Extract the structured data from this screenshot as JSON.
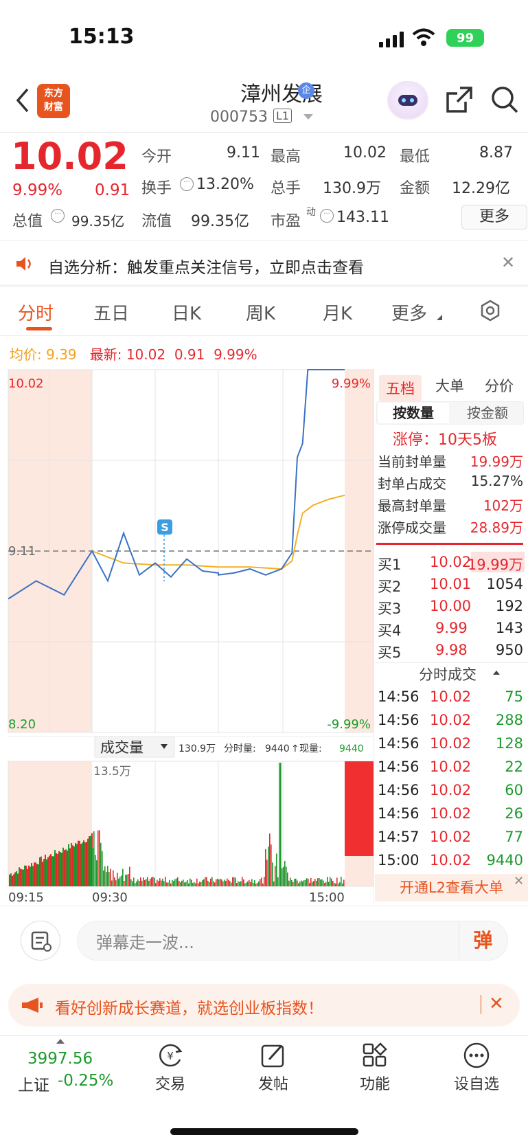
{
  "status_bar": {
    "time": "15:13",
    "battery": "99"
  },
  "header": {
    "logo_text_1": "东方",
    "logo_text_2": "财富",
    "stock_name": "漳州发展",
    "name_badge": "企",
    "stock_code": "000753",
    "level": "L1"
  },
  "quote": {
    "price": "10.02",
    "pct_change": "9.99%",
    "change": "0.91",
    "open_label": "今开",
    "open": "9.11",
    "high_label": "最高",
    "high": "10.02",
    "low_label": "最低",
    "low": "8.87",
    "turnover_label": "换手",
    "turnover": "13.20%",
    "volume_label": "总手",
    "volume": "130.9万",
    "amount_label": "金额",
    "amount": "12.29亿",
    "mktcap_label": "总值",
    "mktcap": "99.35亿",
    "float_label": "流值",
    "float_cap": "99.35亿",
    "pe_label": "市盈",
    "pe_sup": "动",
    "pe": "143.11",
    "more_button": "更多"
  },
  "notice": {
    "text": "自选分析：触发重点关注信号，立即点击查看"
  },
  "tabs": [
    "分时",
    "五日",
    "日K",
    "周K",
    "月K",
    "更多"
  ],
  "info_line": {
    "avg_label": "均价:",
    "avg": "9.39",
    "latest_label": "最新:",
    "latest": "10.02",
    "latest_chg": "0.91",
    "latest_pct": "9.99%"
  },
  "chart_data": {
    "type": "line",
    "title": "",
    "y_max_label": "10.02",
    "y_ref_label": "9.11",
    "y_min_label": "8.20",
    "pct_max_label": "9.99%",
    "pct_min_label": "-9.99%",
    "ylim": [
      8.2,
      10.02
    ],
    "reference_price": 9.11,
    "marker": "S",
    "series": [
      {
        "name": "price",
        "x": [
          "09:15",
          "09:20",
          "09:25",
          "09:30",
          "09:45",
          "10:00",
          "10:15",
          "10:30",
          "10:45",
          "11:00",
          "11:15",
          "11:30",
          "13:00",
          "13:15",
          "13:30",
          "13:45",
          "14:00",
          "14:10",
          "14:15",
          "14:20",
          "14:25",
          "14:30",
          "14:35",
          "14:40",
          "14:45",
          "14:50",
          "14:56",
          "15:00"
        ],
        "values": [
          8.87,
          8.96,
          8.89,
          9.11,
          8.96,
          9.2,
          8.99,
          9.05,
          8.98,
          9.07,
          9.01,
          9.0,
          8.99,
          9.0,
          9.02,
          8.99,
          9.02,
          9.1,
          9.58,
          9.65,
          10.02,
          10.02,
          10.02,
          10.02,
          10.02,
          10.02,
          10.02,
          10.02
        ]
      },
      {
        "name": "avg",
        "x": [
          "09:30",
          "10:00",
          "10:30",
          "11:00",
          "11:30",
          "13:00",
          "13:30",
          "14:00",
          "14:10",
          "14:15",
          "14:20",
          "14:30",
          "14:45",
          "15:00"
        ],
        "values": [
          9.11,
          9.05,
          9.04,
          9.04,
          9.03,
          9.03,
          9.03,
          9.02,
          9.06,
          9.19,
          9.3,
          9.34,
          9.37,
          9.39
        ]
      }
    ],
    "volume": {
      "label": "成交量",
      "total": "130.9万",
      "tick_label": "分时量:",
      "tick_vol": "9440",
      "now_label": "现量:",
      "now_vol": "9440",
      "peak_label": "13.5万"
    },
    "x_tick_labels": [
      "09:15",
      "09:30",
      "15:00"
    ]
  },
  "order_book": {
    "tabs": [
      "五档",
      "大单",
      "分价"
    ],
    "seg": [
      "按数量",
      "按金额"
    ],
    "limit_text": "涨停：10天5板",
    "stats": [
      {
        "label": "当前封单量",
        "value": "19.99万"
      },
      {
        "label": "封单占成交",
        "value": "15.27%"
      },
      {
        "label": "最高封单量",
        "value": "102万"
      },
      {
        "label": "涨停成交量",
        "value": "28.89万"
      }
    ],
    "bids": [
      {
        "label": "买1",
        "price": "10.02",
        "vol": "19.99万"
      },
      {
        "label": "买2",
        "price": "10.01",
        "vol": "1054"
      },
      {
        "label": "买3",
        "price": "10.00",
        "vol": "192"
      },
      {
        "label": "买4",
        "price": "9.99",
        "vol": "143"
      },
      {
        "label": "买5",
        "price": "9.98",
        "vol": "950"
      }
    ]
  },
  "ticks": {
    "header": "分时成交",
    "rows": [
      {
        "time": "14:56",
        "price": "10.02",
        "vol": "75"
      },
      {
        "time": "14:56",
        "price": "10.02",
        "vol": "288"
      },
      {
        "time": "14:56",
        "price": "10.02",
        "vol": "128"
      },
      {
        "time": "14:56",
        "price": "10.02",
        "vol": "22"
      },
      {
        "time": "14:56",
        "price": "10.02",
        "vol": "60"
      },
      {
        "time": "14:56",
        "price": "10.02",
        "vol": "26"
      },
      {
        "time": "14:57",
        "price": "10.02",
        "vol": "77"
      },
      {
        "time": "15:00",
        "price": "10.02",
        "vol": "9440"
      }
    ],
    "l2_banner": "开通L2查看大单"
  },
  "danmaku": {
    "placeholder": "弹幕走一波...",
    "button": "弹"
  },
  "ad": {
    "text": "看好创新成长赛道，就选创业板指数！"
  },
  "bottom_nav": {
    "index_value": "3997.56",
    "index_name": "上证",
    "index_change": "-0.25%",
    "items": [
      "交易",
      "发帖",
      "功能",
      "设自选"
    ]
  }
}
